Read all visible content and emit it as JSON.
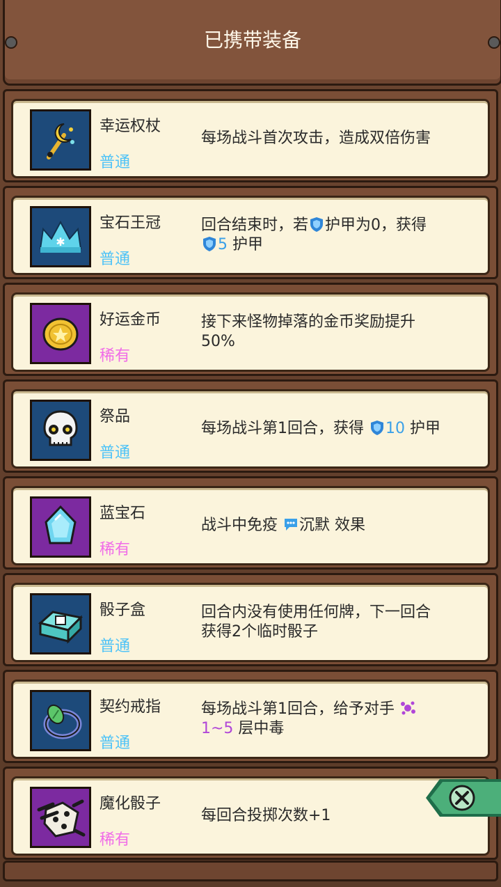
{
  "header": {
    "title": "已携带装备"
  },
  "items": [
    {
      "name": "幸运权杖",
      "rarity": "普通",
      "rarity_type": "common",
      "icon": "scepter-icon",
      "desc": [
        "每场战斗首次攻击，造成双倍伤害"
      ]
    },
    {
      "name": "宝石王冠",
      "rarity": "普通",
      "rarity_type": "common",
      "icon": "crown-icon",
      "desc_parts": {
        "line1_pre": "回合结束时，若",
        "line1_post": "护甲为0，获得",
        "line2_value": "5",
        "line2_post": " 护甲"
      }
    },
    {
      "name": "好运金币",
      "rarity": "稀有",
      "rarity_type": "rare",
      "icon": "coin-icon",
      "desc": [
        "接下来怪物掉落的金币奖励提升",
        "50%"
      ]
    },
    {
      "name": "祭品",
      "rarity": "普通",
      "rarity_type": "common",
      "icon": "skull-icon",
      "desc_parts": {
        "pre": "每场战斗第1回合，获得 ",
        "value": "10",
        "post": " 护甲"
      }
    },
    {
      "name": "蓝宝石",
      "rarity": "稀有",
      "rarity_type": "rare",
      "icon": "sapphire-icon",
      "desc_parts": {
        "pre": "战斗中免疫 ",
        "value": "沉默",
        "post": " 效果"
      }
    },
    {
      "name": "骰子盒",
      "rarity": "普通",
      "rarity_type": "common",
      "icon": "dice-box-icon",
      "desc": [
        "回合内没有使用任何牌，下一回合",
        "获得2个临时骰子"
      ]
    },
    {
      "name": "契约戒指",
      "rarity": "普通",
      "rarity_type": "common",
      "icon": "ring-icon",
      "desc_parts": {
        "line1": "每场战斗第1回合，给予对手 ",
        "value": "1~5",
        "post": " 层中毒"
      }
    },
    {
      "name": "魔化骰子",
      "rarity": "稀有",
      "rarity_type": "rare",
      "icon": "demon-dice-icon",
      "desc": [
        "每回合投掷次数+1"
      ]
    }
  ],
  "close_button": {
    "icon": "close-icon"
  },
  "colors": {
    "common_text": "#4fc3f7",
    "rare_text": "#f06ce8",
    "common_bg": "#1d4a7a",
    "rare_bg": "#7c2aa0",
    "card_bg": "#fbf4dc",
    "wood": "#82543c"
  }
}
